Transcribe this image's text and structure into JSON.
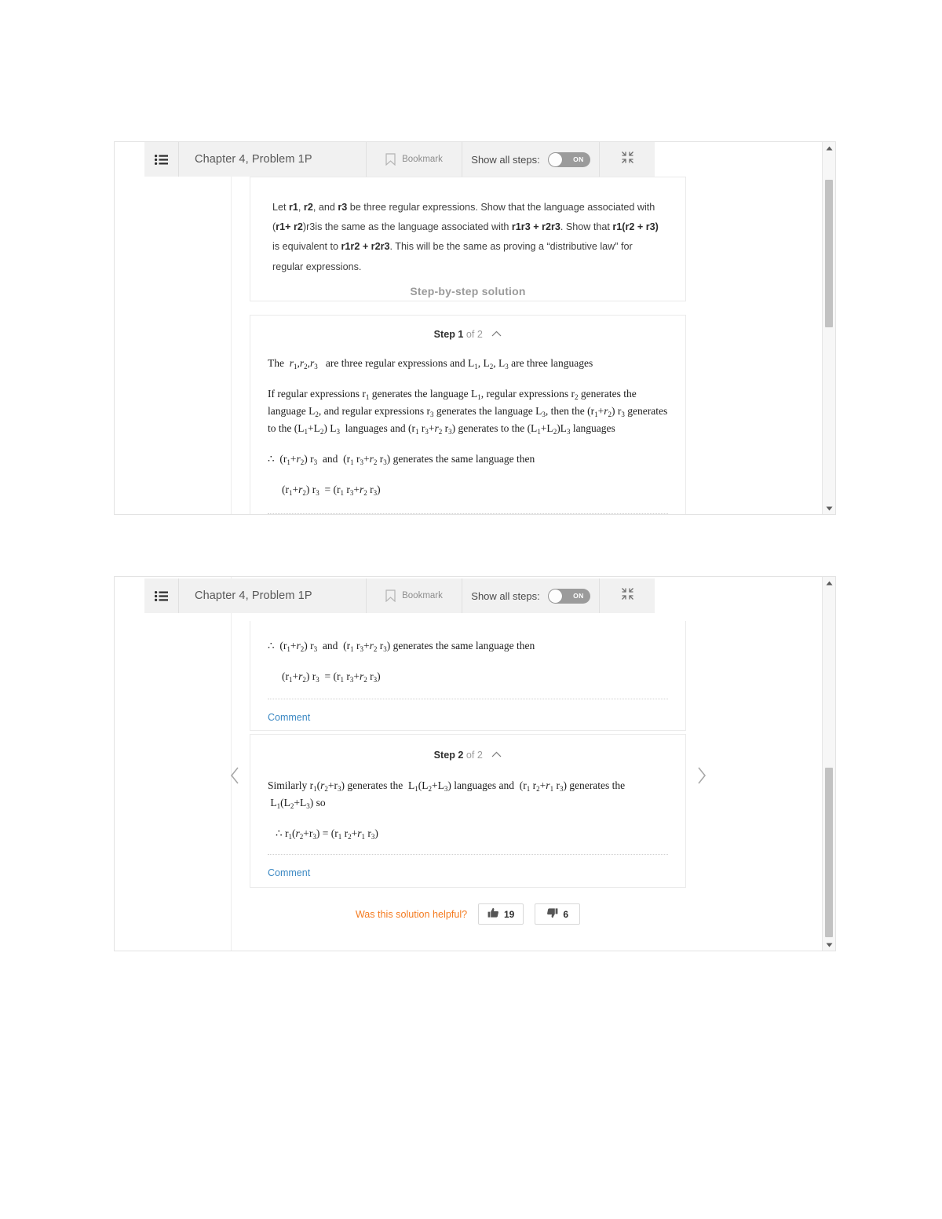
{
  "page": {
    "background": "#ffffff",
    "accent_orange": "#f47b20",
    "link_blue": "#3b88c3"
  },
  "toolbar": {
    "list_icon": "list-icon",
    "title": "Chapter 4, Problem 1P",
    "bookmark_icon": "bookmark-icon",
    "bookmark_label": "Bookmark",
    "show_all_steps_label": "Show all steps:",
    "toggle_state": "ON",
    "collapse_icon": "collapse-icon"
  },
  "problem": {
    "line1_a": "Let ",
    "r1": "r1",
    "sep1": ", ",
    "r2": "r2",
    "sep2": ", and ",
    "r3": "r3",
    "line1_b": " be three regular expressions. Show that the language associated with (",
    "r1b": "r1",
    "plus": "+",
    "r2b": "r2",
    "line2_a": ")r3is the same as the language associated with ",
    "r1r3": "r1r3",
    "plus2": " + ",
    "r2r3": "r2r3",
    "line2_b": ". Show that ",
    "r1r2r3": "r1(r2 + r3)",
    "line2_c": " is equivalent",
    "line3_a": "to ",
    "r1r2": "r1r2 + r2r3",
    "line3_b": ". This will be the same as proving a “distributive law” for regular expressions.",
    "full_text": "Let r1, r2, and r3 be three regular expressions. Show that the language associated with (r1+ r2)r3is the same as the language associated with r1r3 + r2r3. Show that r1(r2 + r3) is equivalent to r1r2 + r2r3. This will be the same as proving a “distributive law” for regular expressions."
  },
  "solution": {
    "heading": "Step-by-step solution",
    "steps": [
      {
        "label_bold": "Step 1",
        "label_rest": "of 2",
        "chevron": "chevron-up-icon",
        "comment_label": "Comment"
      },
      {
        "label_bold": "Step 2",
        "label_rest": "of 2",
        "chevron": "chevron-up-icon",
        "comment_label": "Comment"
      }
    ]
  },
  "step1": {
    "p1_pre": "The ",
    "p1_vars": "r1, r2, r3",
    "p1_mid": " are three regular expressions and ",
    "p1_langs": "L1, L2, L3",
    "p1_post": " are three languages",
    "p2_l1": "If regular expressions r1 generates the language L1, regular expressions r2 generates the",
    "p2_l2": "language L2, and regular expressions r3 generates the language L3, then the",
    "p2_l3": "(r1+r2) r3 generates to the (L1+L2) L3 languages and (r1 r3+r2 r3) generates to the",
    "p2_l4": "(L1+L2)L3 languages",
    "p3": "∴ (r1+r2) r3  and  (r1 r3+r2 r3) generates the same language then",
    "p4": "(r1+r2) r3  = (r1 r3+r2 r3)"
  },
  "step2": {
    "p1_l1": "Similarly r1(r2+r3) generates the  L1(L2+L3) languages and  (r1 r2+r1 r3) generates",
    "p1_l2": "the  L1(L2+L3) so",
    "p2": "∴ r1(r2+r3) = (r1 r2+r1 r3)"
  },
  "helpful": {
    "question": "Was this solution helpful?",
    "up_icon": "thumbs-up-icon",
    "up_count": "19",
    "down_icon": "thumbs-down-icon",
    "down_count": "6"
  },
  "nav": {
    "prev_icon": "chevron-left-icon",
    "next_icon": "chevron-right-icon"
  },
  "scrollbar": {
    "up_icon": "scroll-up-arrow-icon",
    "down_icon": "scroll-down-arrow-icon",
    "thumb": "scrollbar-thumb"
  }
}
